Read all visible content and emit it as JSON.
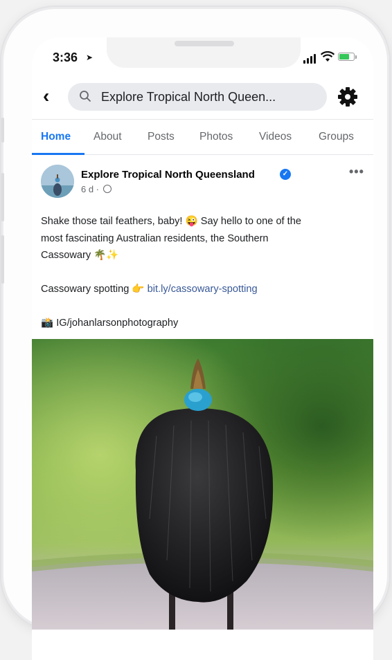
{
  "status_bar": {
    "time": "3:36"
  },
  "search": {
    "query": "Explore Tropical North Queen..."
  },
  "tabs": [
    {
      "label": "Home"
    },
    {
      "label": "About"
    },
    {
      "label": "Posts"
    },
    {
      "label": "Photos"
    },
    {
      "label": "Videos"
    },
    {
      "label": "Groups"
    }
  ],
  "post": {
    "page_name": "Explore Tropical North Queensland",
    "age": "6 d ·",
    "line1": "Shake those tail feathers, baby! 😜 Say hello to one of the",
    "line2": "most fascinating Australian residents, the Southern",
    "line3": "Cassowary 🌴✨",
    "spotting_label": "Cassowary spotting 👉",
    "spotting_link": "bit.ly/cassowary-spotting",
    "credit": "📸 IG/johanlarsonphotography"
  },
  "colors": {
    "accent": "#1877f2",
    "link": "#385898",
    "battery": "#34c759"
  }
}
